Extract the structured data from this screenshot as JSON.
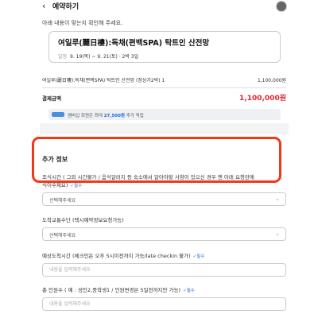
{
  "header": {
    "back_icon": "chevron-left-icon",
    "title": "예약하기"
  },
  "subtitle": "아래 내용이 맞는지 확인해 주세요.",
  "booking": {
    "title": "여일루(麗日樓):독채(편백SPA) 탁트인 산전망",
    "dates_label": "일정",
    "dates": "9. 19(목) ~ 9. 21(토) · 2박 3일"
  },
  "line_item": {
    "name": "여일루(麗日樓):독채(편백SPA) 탁트인 산전망 (정상가2박) 1",
    "amount": "1,100,000원"
  },
  "total": {
    "label": "결제금액",
    "amount": "1,100,000원"
  },
  "membership": {
    "text_before": "멤버십 회원은 최대",
    "points": "27,500원",
    "text_after": "추가 적립"
  },
  "extra": {
    "title": "추가 정보",
    "description": "조식시간 ( 그외 시간불가 / 음식알러지 등 숙소에서 알아야할 사항이 있으신 경우 맨 아래 요청란에",
    "fields": [
      {
        "label": "식이수제요)",
        "required": "✓필수",
        "type": "select",
        "value": "선택해주세요"
      },
      {
        "label": "도착교통수단 (택시예약정보요청가능)",
        "required": "",
        "type": "select",
        "value": "선택해주세요"
      },
      {
        "label": "예상도착시간 (체크인은 오후 5시이전까지 가능/late checkin 불가)",
        "required": "✓필수",
        "type": "input",
        "placeholder": "내용을 입력해주세요"
      },
      {
        "label": "총 인원수 ( 예 : 성인2,중학생1 / 인원변경은 5일전까지만 가능)",
        "required": "✓필수",
        "type": "input",
        "placeholder": "내용을 입력해주세요"
      }
    ]
  },
  "colors": {
    "highlight": "#f03a17",
    "price": "#e4262f",
    "required": "#1b66d6"
  }
}
